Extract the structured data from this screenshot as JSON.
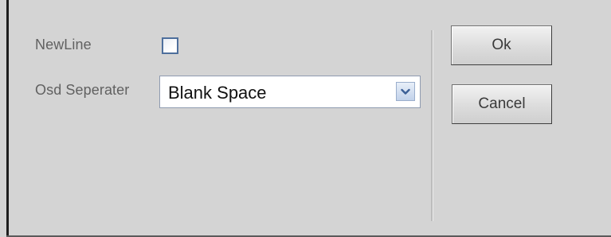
{
  "form": {
    "newline_label": "NewLine",
    "newline_checked": false,
    "separator_label": "Osd Seperater",
    "separator_value": "Blank Space"
  },
  "buttons": {
    "ok_label": "Ok",
    "cancel_label": "Cancel"
  },
  "icons": {
    "dropdown": "chevron-down-icon"
  },
  "colors": {
    "background": "#d4d4d4",
    "label_text": "#616161",
    "checkbox_border": "#4e6f9c",
    "dropdown_arrow": "#3b5f96"
  }
}
